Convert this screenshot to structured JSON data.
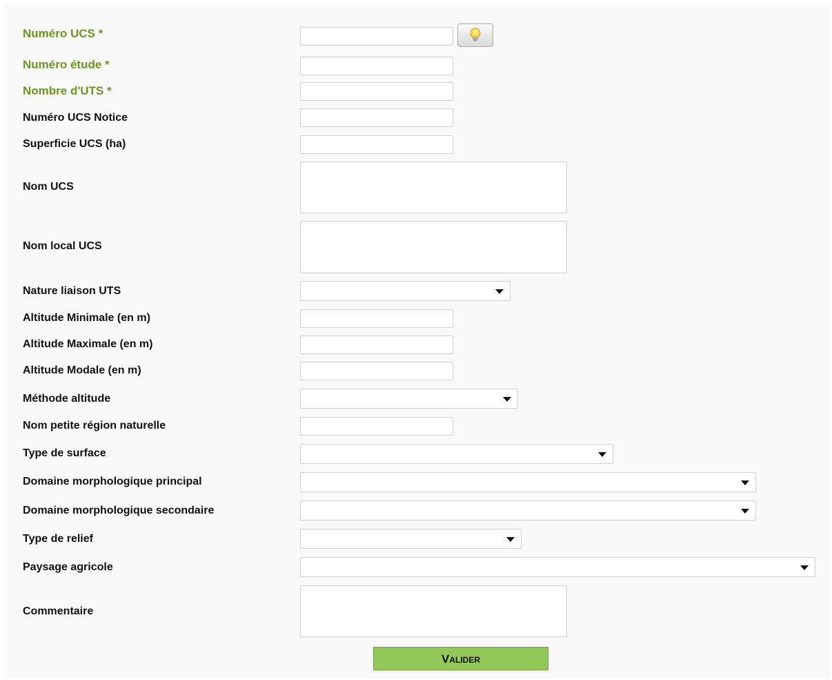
{
  "form": {
    "fields": [
      {
        "label": "Numéro UCS *",
        "value": ""
      },
      {
        "label": "Numéro étude *",
        "value": ""
      },
      {
        "label": "Nombre d'UTS *",
        "value": ""
      },
      {
        "label": "Numéro UCS Notice",
        "value": ""
      },
      {
        "label": "Superficie UCS (ha)",
        "value": ""
      },
      {
        "label": "Nom UCS",
        "value": ""
      },
      {
        "label": "Nom local UCS",
        "value": ""
      },
      {
        "label": "Nature liaison UTS",
        "value": ""
      },
      {
        "label": "Altitude Minimale (en m)",
        "value": ""
      },
      {
        "label": "Altitude Maximale (en m)",
        "value": ""
      },
      {
        "label": "Altitude Modale (en m)",
        "value": ""
      },
      {
        "label": "Méthode altitude",
        "value": ""
      },
      {
        "label": "Nom petite région naturelle",
        "value": ""
      },
      {
        "label": "Type de surface",
        "value": ""
      },
      {
        "label": "Domaine morphologique principal",
        "value": ""
      },
      {
        "label": "Domaine morphologique secondaire",
        "value": ""
      },
      {
        "label": "Type de relief",
        "value": ""
      },
      {
        "label": "Paysage agricole",
        "value": ""
      },
      {
        "label": "Commentaire",
        "value": ""
      }
    ],
    "submit_label": "Valider",
    "hint_icon": "lightbulb-icon"
  },
  "colors": {
    "required_label": "#6b961f",
    "submit_bg": "#92c75a",
    "panel_bg": "#f9f9f9"
  }
}
